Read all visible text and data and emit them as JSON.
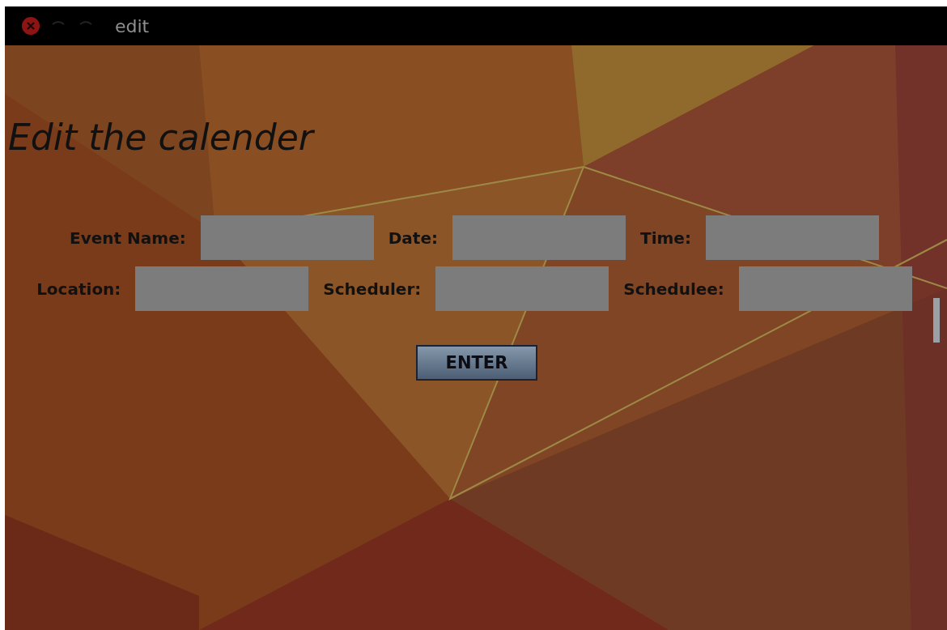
{
  "window": {
    "title": "edit"
  },
  "heading": "Edit the calender",
  "form": {
    "fields": [
      {
        "label": "Event Name:"
      },
      {
        "label": "Date:"
      },
      {
        "label": "Time:"
      },
      {
        "label": "Location:"
      },
      {
        "label": "Scheduler:"
      },
      {
        "label": "Schedulee:"
      }
    ]
  },
  "button": "ENTER"
}
